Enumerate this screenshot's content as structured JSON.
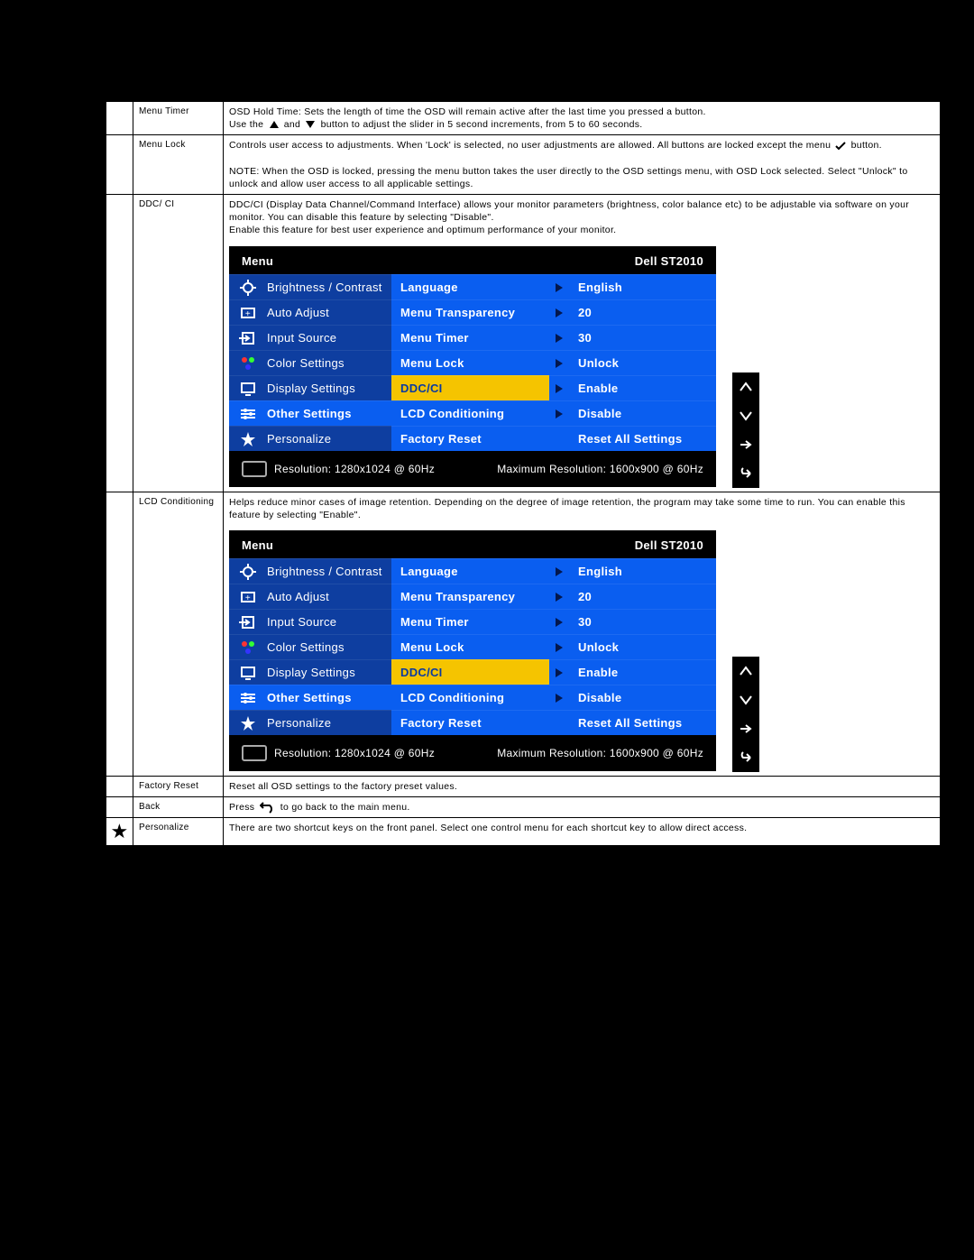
{
  "rows": {
    "menu_timer": {
      "label": "Menu Timer",
      "desc_l1": "OSD Hold Time: Sets the length of time the OSD will remain active after the last time you pressed a button.",
      "desc_l2a": "Use the",
      "desc_l2b": "and",
      "desc_l2c": "button to adjust the slider in 5 second increments, from 5 to 60 seconds."
    },
    "menu_lock": {
      "label": "Menu Lock",
      "p1": "Controls user access to adjustments. When 'Lock' is selected, no user adjustments are allowed. All buttons are locked except the menu",
      "p1_tail": "button.",
      "p2": "NOTE: When the OSD is locked, pressing the menu button takes the user directly to the OSD settings menu, with OSD Lock selected. Select \"Unlock\" to unlock and allow user access to all applicable settings."
    },
    "ddc_ci": {
      "label": "DDC/ CI",
      "p1": "DDC/CI (Display Data Channel/Command Interface) allows your monitor parameters (brightness, color balance etc) to be adjustable via software on your monitor. You can disable this feature by selecting \"Disable\".",
      "p2": "Enable this feature for best user experience and optimum performance of your monitor."
    },
    "lcd_cond": {
      "label": "LCD Conditioning",
      "p1": "Helps reduce minor cases of image retention. Depending on the degree of image retention, the program may take some time to run. You can enable this feature by selecting \"Enable\"."
    },
    "factory_reset": {
      "label": "Factory Reset",
      "p1": "Reset all OSD settings to the factory preset values."
    },
    "back": {
      "label": "Back",
      "p1a": "Press",
      "p1b": "to go back to the main menu."
    },
    "personalize": {
      "label": "Personalize",
      "p1": "There are two shortcut keys on the front panel. Select one control menu for each shortcut key to allow direct access."
    }
  },
  "osd": {
    "title_left": "Menu",
    "title_right": "Dell ST2010",
    "left_items": [
      "Brightness / Contrast",
      "Auto Adjust",
      "Input Source",
      "Color Settings",
      "Display Settings",
      "Other Settings",
      "Personalize"
    ],
    "mid_items": [
      "Language",
      "Menu Transparency",
      "Menu Timer",
      "Menu Lock",
      "DDC/CI",
      "LCD Conditioning",
      "Factory Reset"
    ],
    "right_items": [
      "English",
      "20",
      "30",
      "Unlock",
      "Enable",
      "Disable",
      "Reset All Settings"
    ],
    "highlight_index": 4,
    "active_left_index": 5,
    "resolution": "Resolution: 1280x1024 @ 60Hz",
    "max_res": "Maximum Resolution: 1600x900 @ 60Hz"
  }
}
